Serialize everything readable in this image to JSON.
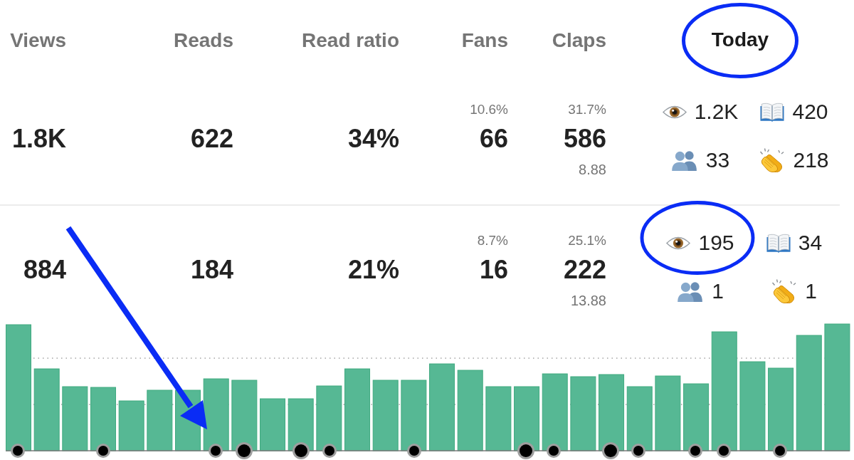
{
  "header": {
    "columns": [
      "Views",
      "Reads",
      "Read ratio",
      "Fans",
      "Claps"
    ],
    "today": {
      "label": "Today",
      "circled": true
    }
  },
  "rows": [
    {
      "cells": [
        {
          "value": "1.8K"
        },
        {
          "value": "622"
        },
        {
          "value": "34%"
        },
        {
          "value": "66",
          "percent": "10.6%"
        },
        {
          "value": "586",
          "percent": "31.7%",
          "per_fan": "8.88"
        }
      ],
      "today": [
        {
          "kind": "views",
          "value": "1.2K",
          "circled": false
        },
        {
          "kind": "reads",
          "value": "420",
          "circled": false
        },
        {
          "kind": "fans",
          "value": "33",
          "circled": false
        },
        {
          "kind": "claps",
          "value": "218",
          "circled": false
        }
      ]
    },
    {
      "cells": [
        {
          "value": "884"
        },
        {
          "value": "184"
        },
        {
          "value": "21%"
        },
        {
          "value": "16",
          "percent": "8.7%"
        },
        {
          "value": "222",
          "percent": "25.1%",
          "per_fan": "13.88"
        }
      ],
      "today": [
        {
          "kind": "views",
          "value": "195",
          "circled": true
        },
        {
          "kind": "reads",
          "value": "34",
          "circled": false
        },
        {
          "kind": "fans",
          "value": "1",
          "circled": false
        },
        {
          "kind": "claps",
          "value": "1",
          "circled": false
        }
      ]
    }
  ]
}
